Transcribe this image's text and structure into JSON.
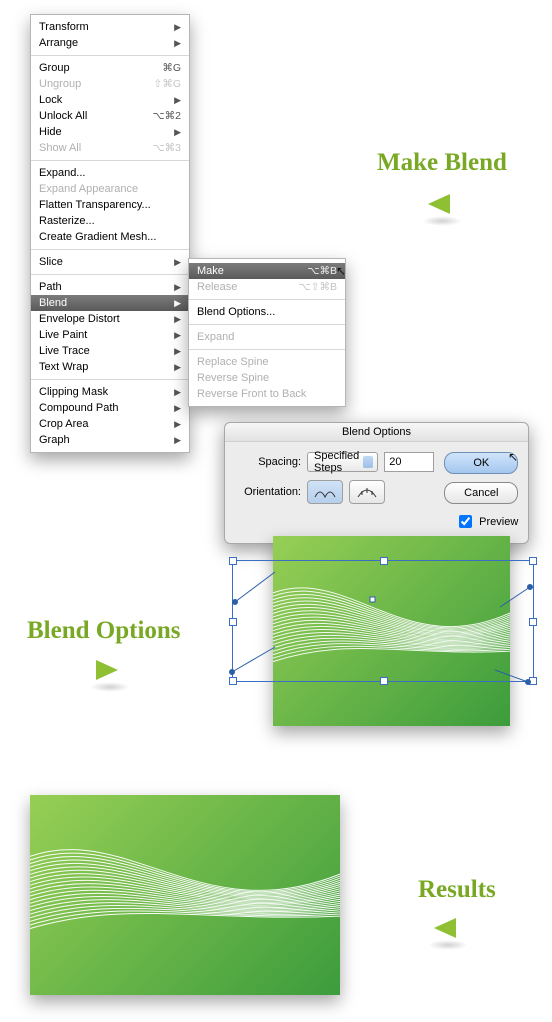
{
  "titles": {
    "make": "Make Blend",
    "opts": "Blend Options",
    "results": "Results"
  },
  "menu": {
    "items": [
      {
        "label": "Transform",
        "sub": true
      },
      {
        "label": "Arrange",
        "sub": true
      },
      {
        "sep": true
      },
      {
        "label": "Group",
        "sc": "⌘G"
      },
      {
        "label": "Ungroup",
        "sc": "⇧⌘G",
        "disabled": true
      },
      {
        "label": "Lock",
        "sub": true
      },
      {
        "label": "Unlock All",
        "sc": "⌥⌘2"
      },
      {
        "label": "Hide",
        "sub": true
      },
      {
        "label": "Show All",
        "sc": "⌥⌘3",
        "disabled": true
      },
      {
        "sep": true
      },
      {
        "label": "Expand..."
      },
      {
        "label": "Expand Appearance",
        "disabled": true
      },
      {
        "label": "Flatten Transparency..."
      },
      {
        "label": "Rasterize..."
      },
      {
        "label": "Create Gradient Mesh..."
      },
      {
        "sep": true
      },
      {
        "label": "Slice",
        "sub": true
      },
      {
        "sep": true
      },
      {
        "label": "Path",
        "sub": true
      },
      {
        "label": "Blend",
        "sub": true,
        "selected": true
      },
      {
        "label": "Envelope Distort",
        "sub": true
      },
      {
        "label": "Live Paint",
        "sub": true
      },
      {
        "label": "Live Trace",
        "sub": true
      },
      {
        "label": "Text Wrap",
        "sub": true
      },
      {
        "sep": true
      },
      {
        "label": "Clipping Mask",
        "sub": true
      },
      {
        "label": "Compound Path",
        "sub": true
      },
      {
        "label": "Crop Area",
        "sub": true
      },
      {
        "label": "Graph",
        "sub": true
      }
    ]
  },
  "submenu": {
    "items": [
      {
        "label": "Make",
        "sc": "⌥⌘B",
        "selected": true
      },
      {
        "label": "Release",
        "sc": "⌥⇧⌘B",
        "disabled": true
      },
      {
        "sep": true
      },
      {
        "label": "Blend Options..."
      },
      {
        "sep": true
      },
      {
        "label": "Expand",
        "disabled": true
      },
      {
        "sep": true
      },
      {
        "label": "Replace Spine",
        "disabled": true
      },
      {
        "label": "Reverse Spine",
        "disabled": true
      },
      {
        "label": "Reverse Front to Back",
        "disabled": true
      }
    ]
  },
  "dialog": {
    "title": "Blend Options",
    "spacingLabel": "Spacing:",
    "spacingMode": "Specified Steps",
    "spacingValue": "20",
    "orientationLabel": "Orientation:",
    "ok": "OK",
    "cancel": "Cancel",
    "preview": "Preview"
  }
}
